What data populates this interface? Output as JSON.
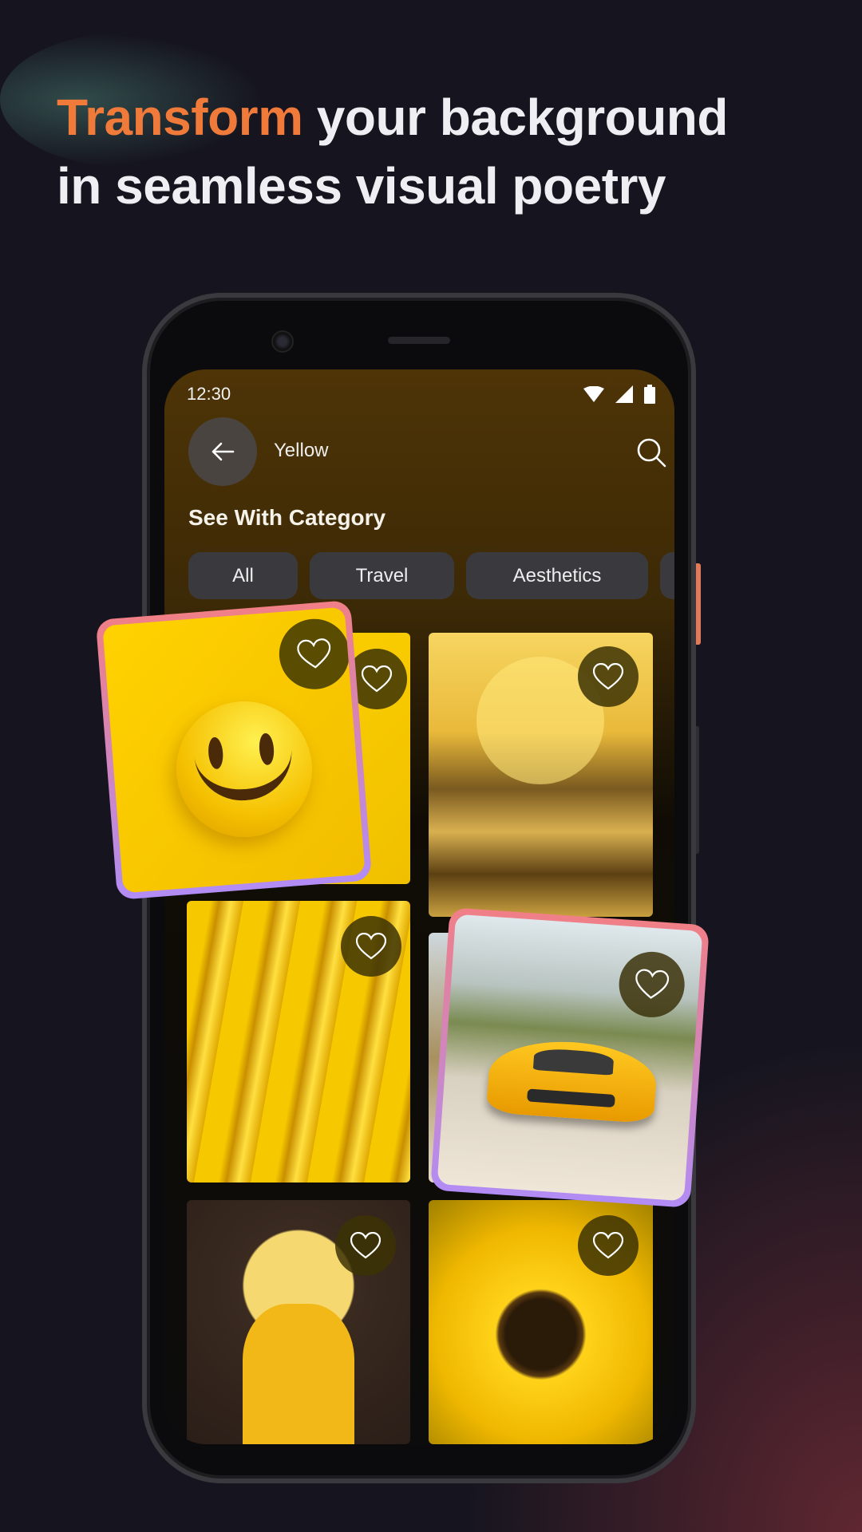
{
  "headline": {
    "accent": "Transform",
    "rest_line1": " your background",
    "line2": "in seamless visual poetry"
  },
  "status_bar": {
    "time": "12:30",
    "icons": [
      "wifi-icon",
      "signal-icon",
      "battery-icon"
    ]
  },
  "app_bar": {
    "back_icon": "arrow-left-icon",
    "title": "Yellow",
    "search_icon": "search-icon"
  },
  "section_title": "See With Category",
  "categories": [
    {
      "label": "All"
    },
    {
      "label": "Travel"
    },
    {
      "label": "Aesthetics"
    }
  ],
  "wallpapers": [
    {
      "subject": "smiley",
      "favorite_icon": "heart-outline-icon"
    },
    {
      "subject": "great wave",
      "favorite_icon": "heart-outline-icon"
    },
    {
      "subject": "abstract waves",
      "favorite_icon": "heart-outline-icon"
    },
    {
      "subject": "sports car",
      "favorite_icon": "heart-outline-icon"
    },
    {
      "subject": "girl with headphones",
      "favorite_icon": "heart-outline-icon"
    },
    {
      "subject": "sunflower",
      "favorite_icon": "heart-outline-icon"
    }
  ],
  "colors": {
    "accent": "#ef7a3a",
    "background": "#16151f",
    "card_border_top": "#f07f86",
    "card_border_bottom": "#b28cf5"
  }
}
